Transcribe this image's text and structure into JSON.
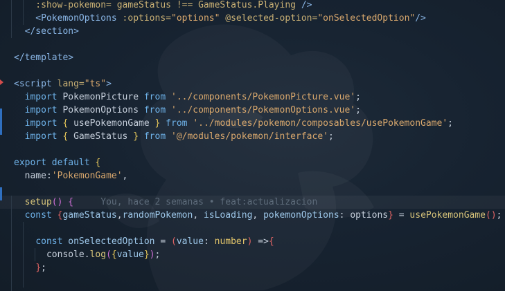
{
  "editor": {
    "lines": [
      [
        [
          "attr",
          "    :show-pokemon= gameStatus !== GameStatus.Playing "
        ],
        [
          "tag",
          "/>"
        ]
      ],
      [
        [
          "tag",
          "    <PokemonOptions "
        ],
        [
          "attr",
          ":options="
        ],
        [
          "str",
          "\"options\""
        ],
        [
          "attr",
          " @selected-option="
        ],
        [
          "str",
          "\"onSelectedOption\""
        ],
        [
          "tag",
          "/>"
        ]
      ],
      [
        [
          "tag",
          "  </section>"
        ]
      ],
      [],
      [
        [
          "tag",
          "</template>"
        ]
      ],
      [],
      [
        [
          "tag",
          "<script "
        ],
        [
          "attr",
          "lang="
        ],
        [
          "str",
          "\"ts\""
        ],
        [
          "tag",
          ">"
        ]
      ],
      [
        [
          "pn",
          "  "
        ],
        [
          "kw",
          "import "
        ],
        [
          "id",
          "PokemonPicture "
        ],
        [
          "kw",
          "from "
        ],
        [
          "str",
          "'../components/PokemonPicture.vue'"
        ],
        [
          "pn",
          ";"
        ]
      ],
      [
        [
          "pn",
          "  "
        ],
        [
          "kw",
          "import "
        ],
        [
          "id",
          "PokemonOptions "
        ],
        [
          "kw",
          "from "
        ],
        [
          "str",
          "'../components/PokemonOptions.vue'"
        ],
        [
          "pn",
          ";"
        ]
      ],
      [
        [
          "pn",
          "  "
        ],
        [
          "kw",
          "import "
        ],
        [
          "br1",
          "{ "
        ],
        [
          "id",
          "usePokemonGame "
        ],
        [
          "br1",
          "} "
        ],
        [
          "kw",
          "from "
        ],
        [
          "str",
          "'../modules/pokemon/composables/usePokemonGame'"
        ],
        [
          "pn",
          ";"
        ]
      ],
      [
        [
          "pn",
          "  "
        ],
        [
          "kw",
          "import "
        ],
        [
          "br1",
          "{ "
        ],
        [
          "id",
          "GameStatus "
        ],
        [
          "br1",
          "} "
        ],
        [
          "kw",
          "from "
        ],
        [
          "str",
          "'@/modules/pokemon/interface'"
        ],
        [
          "pn",
          ";"
        ]
      ],
      [],
      [
        [
          "kw",
          "export default "
        ],
        [
          "br1",
          "{"
        ]
      ],
      [
        [
          "pn",
          "  "
        ],
        [
          "id",
          "name:"
        ],
        [
          "str",
          "'PokemonGame'"
        ],
        [
          "pn",
          ","
        ]
      ],
      [],
      [
        [
          "pn",
          "  "
        ],
        [
          "fn",
          "setup"
        ],
        [
          "br2",
          "("
        ],
        [
          "br2",
          ")"
        ],
        [
          "pn",
          " "
        ],
        [
          "br2",
          "{"
        ],
        [
          "blame",
          "     You, hace 2 semanas • feat:actualizacion"
        ]
      ],
      [
        [
          "pn",
          "  "
        ],
        [
          "kw",
          "const "
        ],
        [
          "br3",
          "{"
        ],
        [
          "vr",
          "gameStatus"
        ],
        [
          "pn",
          ","
        ],
        [
          "vr",
          "randomPokemon"
        ],
        [
          "pn",
          ", "
        ],
        [
          "vr",
          "isLoading"
        ],
        [
          "pn",
          ", "
        ],
        [
          "vr",
          "pokemonOptions"
        ],
        [
          "pn",
          ": "
        ],
        [
          "id",
          "options"
        ],
        [
          "br3",
          "}"
        ],
        [
          "pn",
          " = "
        ],
        [
          "fn",
          "usePokemonGame"
        ],
        [
          "br3",
          "()"
        ],
        [
          "pn",
          ";"
        ]
      ],
      [],
      [
        [
          "pn",
          "    "
        ],
        [
          "kw",
          "const "
        ],
        [
          "vr",
          "onSelectedOption "
        ],
        [
          "pn",
          "= "
        ],
        [
          "br3",
          "("
        ],
        [
          "vr",
          "value"
        ],
        [
          "pn",
          ": "
        ],
        [
          "ty",
          "number"
        ],
        [
          "br3",
          ")"
        ],
        [
          "pn",
          " =>"
        ],
        [
          "br3",
          "{"
        ]
      ],
      [
        [
          "pn",
          "      "
        ],
        [
          "id",
          "console"
        ],
        [
          "pn",
          "."
        ],
        [
          "fn",
          "log"
        ],
        [
          "br2",
          "("
        ],
        [
          "br1",
          "{"
        ],
        [
          "vr",
          "value"
        ],
        [
          "br1",
          "}"
        ],
        [
          "br2",
          ")"
        ],
        [
          "pn",
          ";"
        ]
      ],
      [
        [
          "pn",
          "    "
        ],
        [
          "br3",
          "}"
        ],
        [
          "pn",
          ";"
        ]
      ],
      [],
      []
    ]
  }
}
